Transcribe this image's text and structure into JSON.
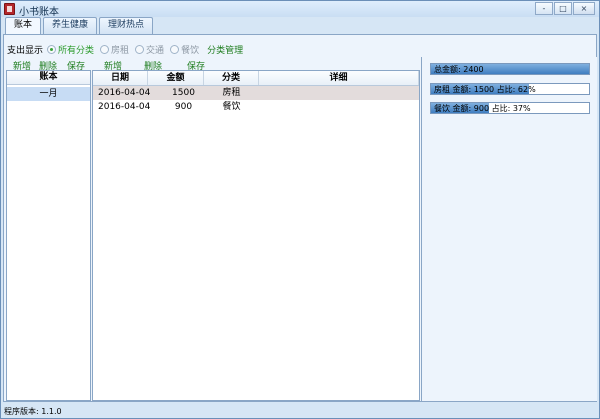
{
  "window": {
    "title": "小书账本"
  },
  "window_controls": {
    "minimize": "-",
    "maximize": "□",
    "close": "×"
  },
  "tabs": [
    {
      "label": "账本",
      "active": true
    },
    {
      "label": "养生健康",
      "active": false
    },
    {
      "label": "理财热点",
      "active": false
    }
  ],
  "filter": {
    "label": "支出显示",
    "options": [
      {
        "label": "所有分类",
        "checked": true
      },
      {
        "label": "房租",
        "checked": false
      },
      {
        "label": "交通",
        "checked": false
      },
      {
        "label": "餐饮",
        "checked": false
      }
    ],
    "category_manage": "分类管理"
  },
  "left_toolbar": {
    "add": "新增",
    "delete": "删除",
    "save": "保存"
  },
  "mid_toolbar": {
    "add": "新增",
    "delete": "删除",
    "save": "保存"
  },
  "ledger_list": {
    "header": "账本",
    "items": [
      {
        "label": "一月"
      }
    ]
  },
  "entries": {
    "columns": [
      "日期",
      "金额",
      "分类",
      "详细"
    ],
    "rows": [
      {
        "date": "2016-04-04",
        "amount": "1500",
        "category": "房租",
        "detail": ""
      },
      {
        "date": "2016-04-04",
        "amount": "900",
        "category": "餐饮",
        "detail": ""
      }
    ]
  },
  "stats": [
    {
      "label": "总金额: 2400",
      "fraction": 1.0
    },
    {
      "label": "房租 金额: 1500 占比: 62%",
      "fraction": 0.62
    },
    {
      "label": "餐饮 金额: 900 占比: 37%",
      "fraction": 0.37
    }
  ],
  "status": {
    "version": "程序版本: 1.1.0"
  },
  "colors": {
    "accent": "#3f7ec0",
    "link": "#1e7d1e",
    "selected_row": "#e3dcdc"
  }
}
